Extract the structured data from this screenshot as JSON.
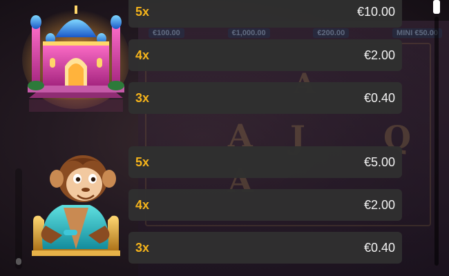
{
  "paytable": {
    "groups": [
      {
        "symbol": "palace",
        "rows": [
          {
            "multiplier": "5x",
            "amount": "€10.00"
          },
          {
            "multiplier": "4x",
            "amount": "€2.00"
          },
          {
            "multiplier": "3x",
            "amount": "€0.40"
          }
        ]
      },
      {
        "symbol": "monkey",
        "rows": [
          {
            "multiplier": "5x",
            "amount": "€5.00"
          },
          {
            "multiplier": "4x",
            "amount": "€2.00"
          },
          {
            "multiplier": "3x",
            "amount": "€0.40"
          }
        ]
      }
    ]
  },
  "background": {
    "jackpots": [
      "€100.00",
      "€1,000.00",
      "€200.00",
      "MINI €50.00"
    ]
  },
  "colors": {
    "multiplier": "#f4b31b",
    "amount": "#f2f2f2",
    "row_background": "#303030"
  }
}
